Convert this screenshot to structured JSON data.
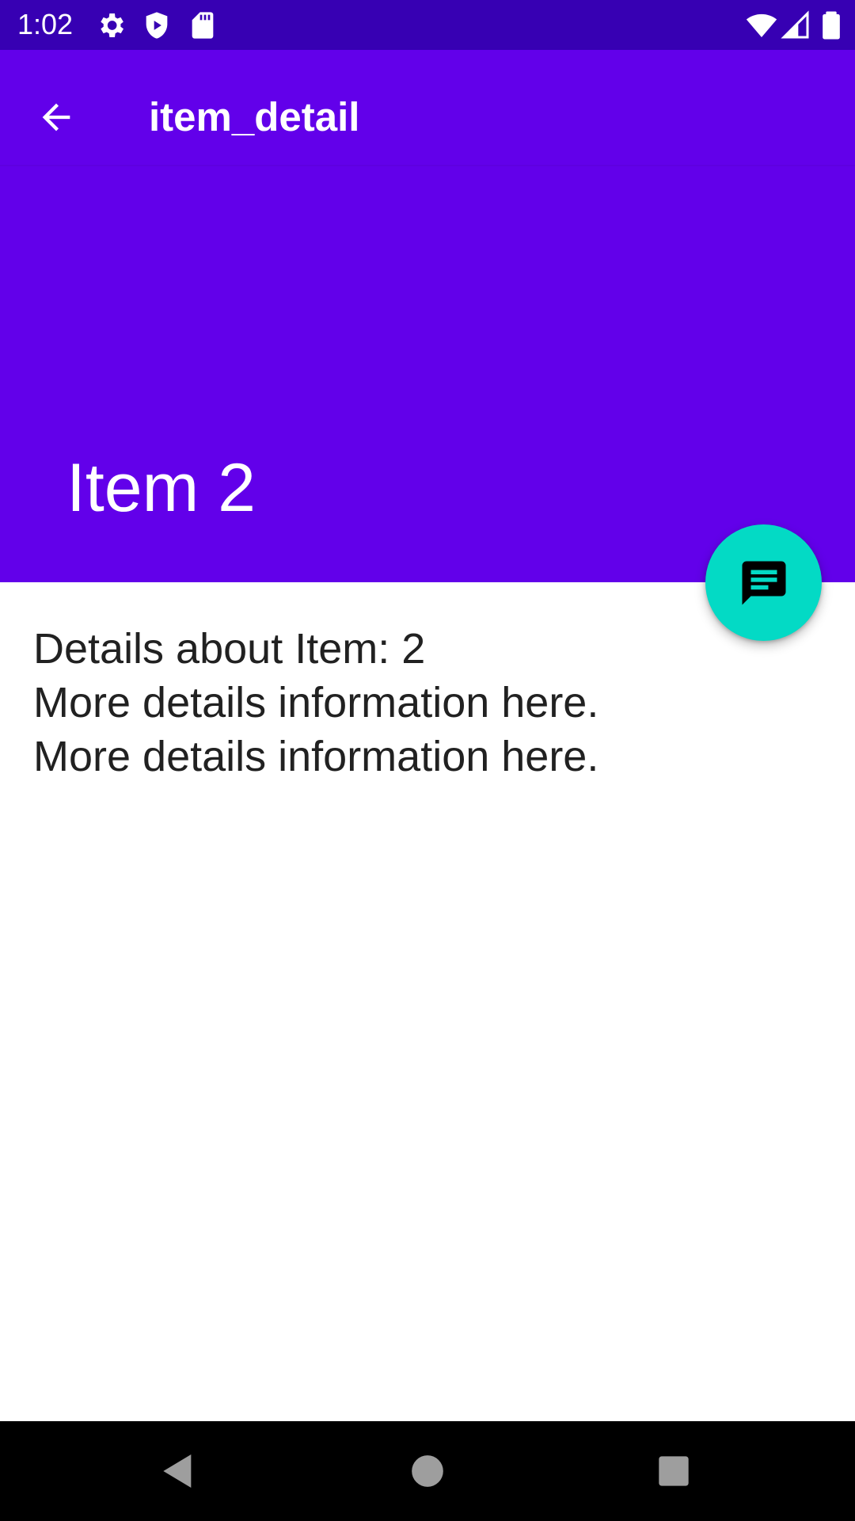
{
  "status_bar": {
    "time": "1:02",
    "left_icons": [
      "gear-icon",
      "shield-play-icon",
      "sd-card-icon"
    ],
    "right_icons": [
      "wifi-icon",
      "signal-icon",
      "battery-icon"
    ],
    "background": "#3700b3"
  },
  "app_bar": {
    "title": "item_detail",
    "back_icon": "arrow-back-icon",
    "background": "#6200ea"
  },
  "header": {
    "title": "Item 2"
  },
  "fab": {
    "icon": "message-icon",
    "background": "#03dac5"
  },
  "content": {
    "lines": [
      "Details about Item: 2",
      "More details information here.",
      "More details information here."
    ]
  },
  "nav_bar": {
    "buttons": [
      "back-triangle-icon",
      "home-circle-icon",
      "recents-square-icon"
    ],
    "background": "#000000"
  }
}
